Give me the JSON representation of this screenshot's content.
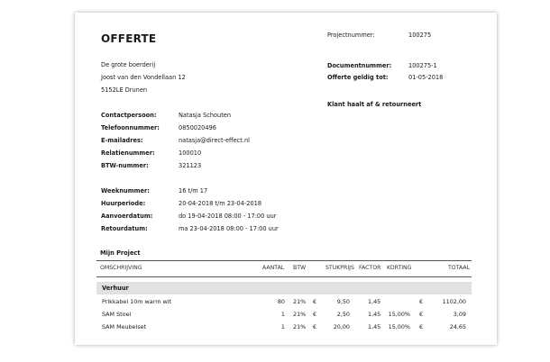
{
  "document": {
    "title": "OFFERTE",
    "customer": {
      "name": "De grote boerderij",
      "street": "Joost van den Vondellaan 12",
      "city": "5152LE Drunen"
    },
    "project_number": {
      "label": "Projectnummer:",
      "value": "100275"
    },
    "document_number": {
      "label": "Documentnummer:",
      "value": "100275-1"
    },
    "valid_until": {
      "label": "Offerte geldig tot:",
      "value": "01-05-2018"
    },
    "pickup_note": "Klant haalt af & retourneert",
    "contact_fields": [
      {
        "label": "Contactpersoon:",
        "value": "Natasja Schouten"
      },
      {
        "label": "Telefoonnummer:",
        "value": "0850020496"
      },
      {
        "label": "E-mailadres:",
        "value": "natasja@direct-effect.nl"
      },
      {
        "label": "Relatienummer:",
        "value": "100010"
      },
      {
        "label": "BTW-nummer:",
        "value": "321123"
      }
    ],
    "period_fields": [
      {
        "label": "Weeknummer:",
        "value": "16 t/m 17"
      },
      {
        "label": "Huurperiode:",
        "value": "20-04-2018 t/m 23-04-2018"
      },
      {
        "label": "Aanvoerdatum:",
        "value": "do 19-04-2018 08:00 - 17:00 uur"
      },
      {
        "label": "Retourdatum:",
        "value": "ma 23-04-2018 08:00 - 17:00 uur"
      }
    ],
    "section_title": "Mijn Project",
    "table": {
      "headers": {
        "description": "OMSCHRIJVING",
        "quantity": "AANTAL",
        "vat": "BTW",
        "unit_price": "STUKPRIJS",
        "factor": "FACTOR",
        "discount": "KORTING",
        "total": "TOTAAL"
      },
      "group": "Verhuur",
      "rows": [
        {
          "description": "Prikkabel 10m warm wit",
          "quantity": "80",
          "vat": "21%",
          "cur1": "€",
          "unit_price": "9,50",
          "factor": "1,45",
          "discount": "",
          "cur2": "€",
          "total": "1102,00"
        },
        {
          "description": "SAM Stoel",
          "quantity": "1",
          "vat": "21%",
          "cur1": "€",
          "unit_price": "2,50",
          "factor": "1,45",
          "discount": "15,00%",
          "cur2": "€",
          "total": "3,09"
        },
        {
          "description": "SAM Meubelset",
          "quantity": "1",
          "vat": "21%",
          "cur1": "€",
          "unit_price": "20,00",
          "factor": "1,45",
          "discount": "15,00%",
          "cur2": "€",
          "total": "24,65"
        }
      ]
    }
  }
}
